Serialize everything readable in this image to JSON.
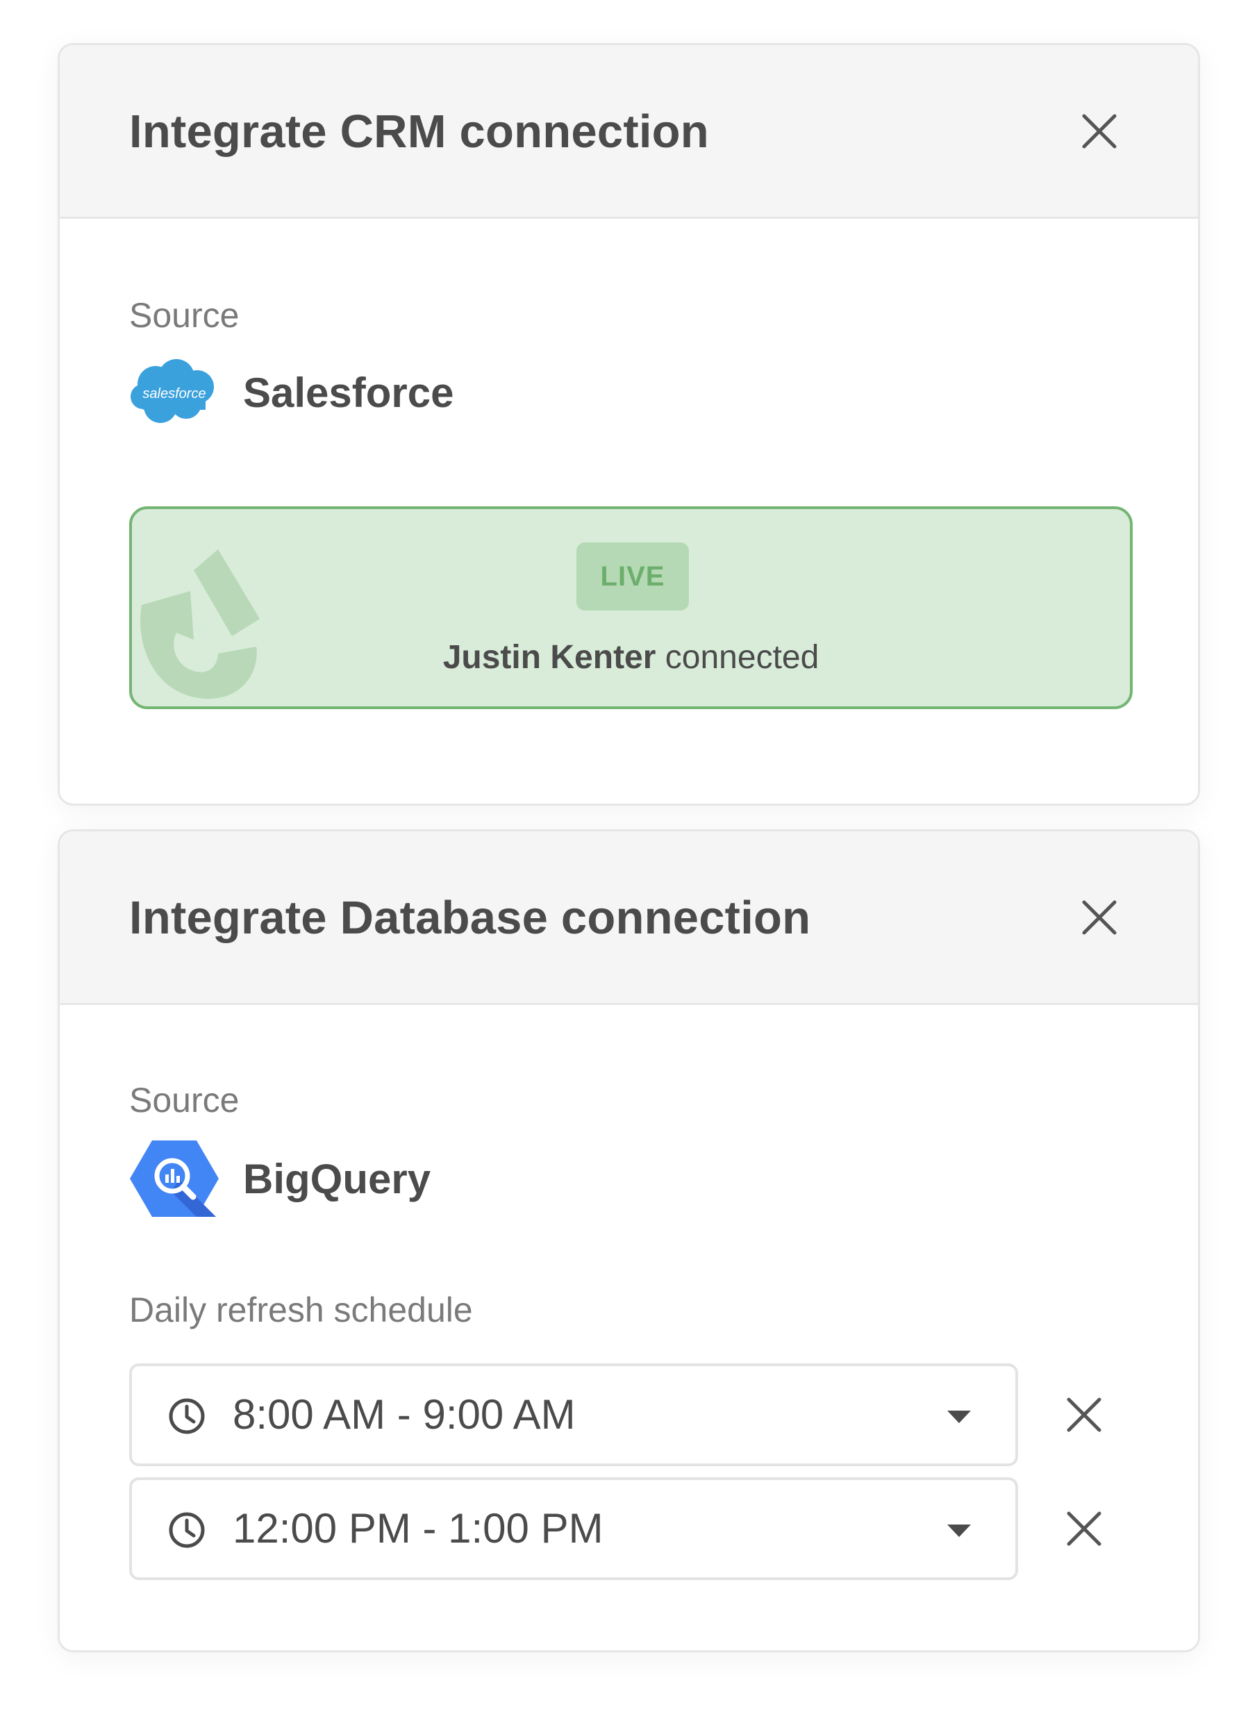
{
  "crm_card": {
    "title": "Integrate CRM connection",
    "source_label": "Source",
    "source_name": "Salesforce",
    "source_logo_text": "salesforce",
    "status_badge": "LIVE",
    "connected_user": "Justin Kenter",
    "connected_suffix": "connected"
  },
  "db_card": {
    "title": "Integrate Database connection",
    "source_label": "Source",
    "source_name": "BigQuery",
    "schedule_label": "Daily refresh schedule",
    "schedule": [
      {
        "time": "8:00 AM - 9:00 AM"
      },
      {
        "time": "12:00 PM - 1:00 PM"
      }
    ]
  },
  "colors": {
    "live_bg": "#d9ecd9",
    "live_border": "#74b574",
    "salesforce_blue": "#3ba1dd",
    "bigquery_blue": "#4285f4"
  },
  "icons": [
    "close-icon",
    "salesforce-logo",
    "bigquery-logo",
    "clock-icon",
    "caret-down-icon"
  ]
}
